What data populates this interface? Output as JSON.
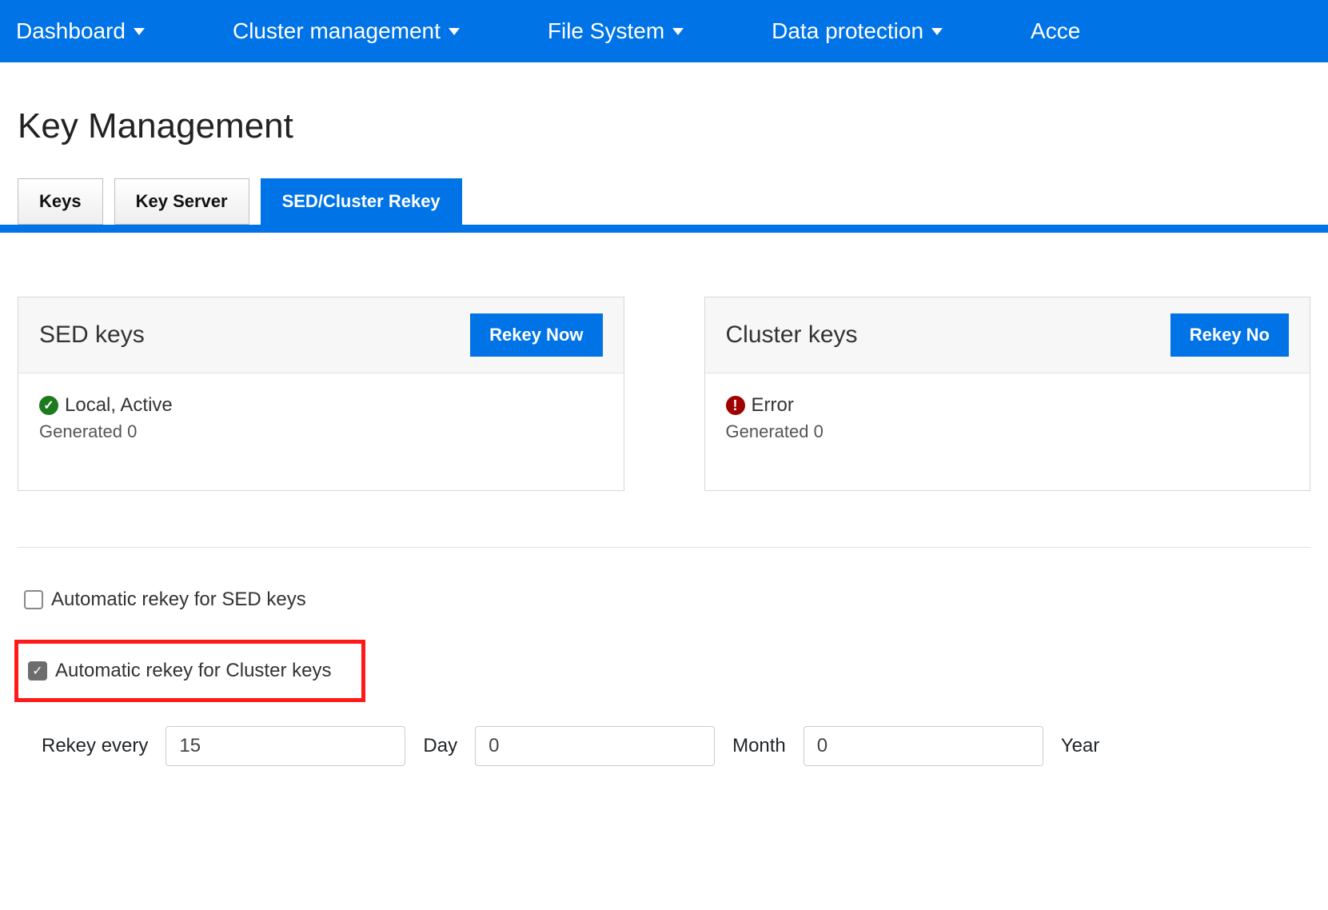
{
  "nav": {
    "items": [
      "Dashboard",
      "Cluster management",
      "File System",
      "Data protection",
      "Acce"
    ]
  },
  "page": {
    "title": "Key Management"
  },
  "tabs": {
    "keys": "Keys",
    "key_server": "Key Server",
    "sed_rekey": "SED/Cluster Rekey"
  },
  "sed_card": {
    "title": "SED keys",
    "button": "Rekey Now",
    "status": "Local, Active",
    "generated_label": "Generated",
    "generated_count": "0"
  },
  "cluster_card": {
    "title": "Cluster keys",
    "button": "Rekey No",
    "status": "Error",
    "generated_label": "Generated",
    "generated_count": "0"
  },
  "auto": {
    "sed_label": "Automatic rekey for SED keys",
    "cluster_label": "Automatic rekey for Cluster keys",
    "sed_checked": false,
    "cluster_checked": true
  },
  "schedule": {
    "prefix": "Rekey every",
    "day_value": "15",
    "day_label": "Day",
    "month_value": "0",
    "month_label": "Month",
    "year_value": "0",
    "year_label": "Year"
  }
}
